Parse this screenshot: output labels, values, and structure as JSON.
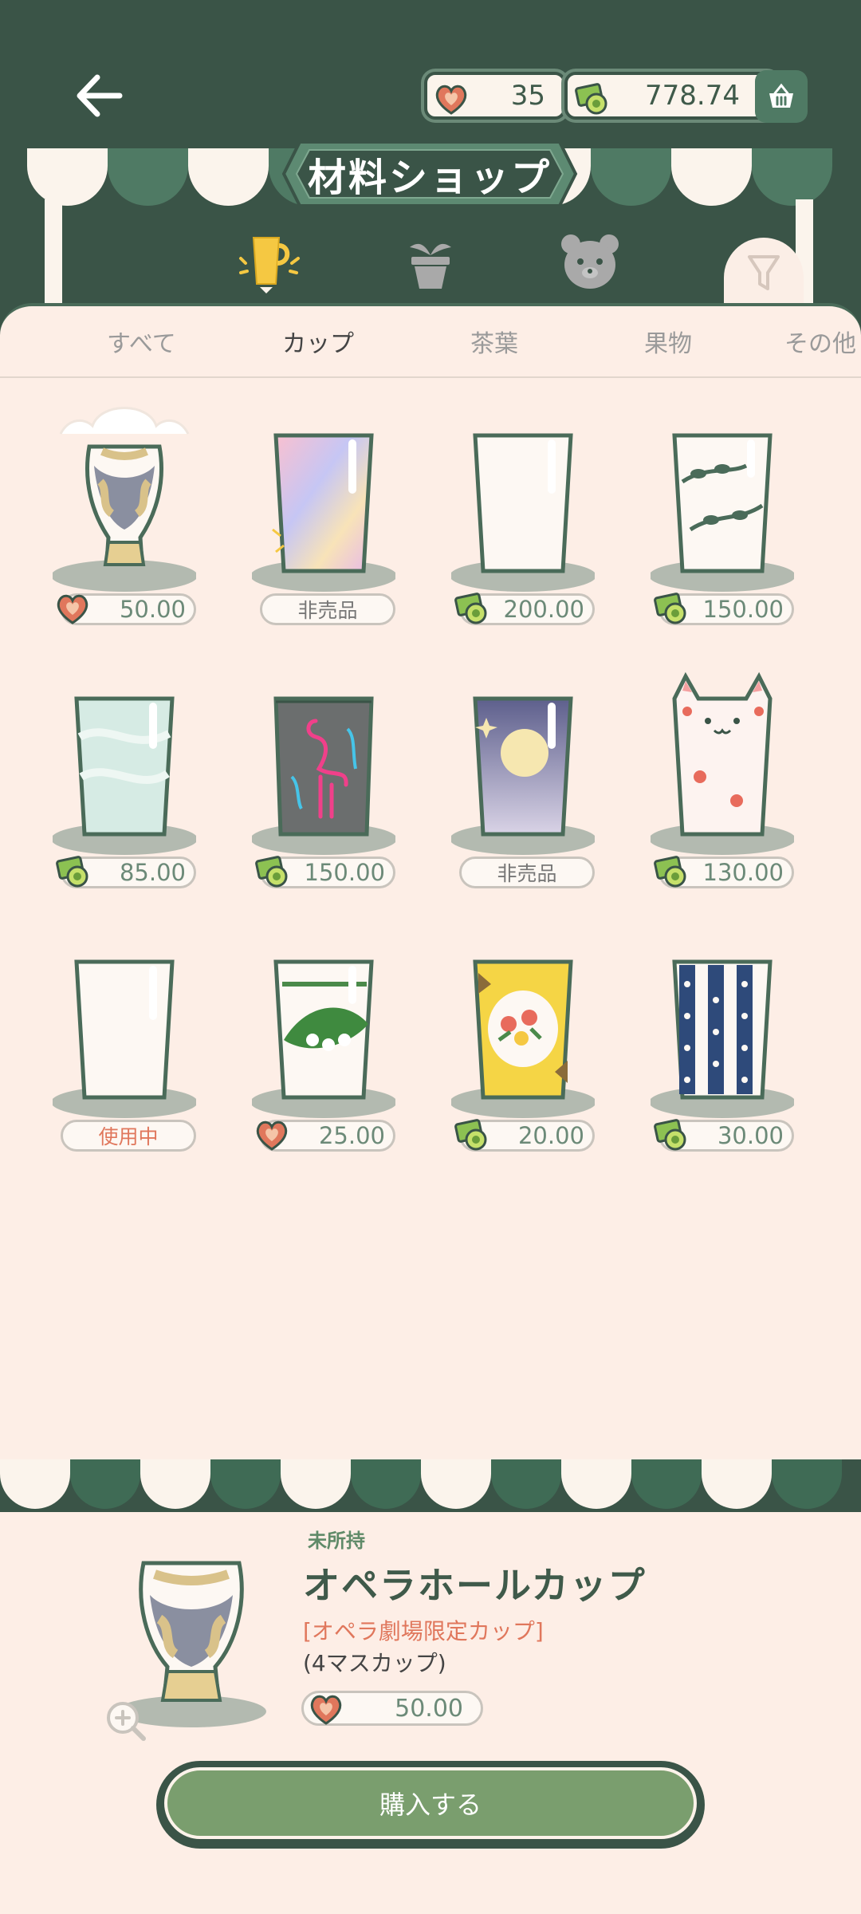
{
  "header": {
    "title": "材料ショップ",
    "hearts": "35",
    "money": "778.74"
  },
  "categories": [
    {
      "name": "cup-icon",
      "active": true
    },
    {
      "name": "plant-pot-icon",
      "active": false
    },
    {
      "name": "bear-icon",
      "active": false
    }
  ],
  "tabs": [
    {
      "label": "すべて"
    },
    {
      "label": "カップ"
    },
    {
      "label": "茶葉"
    },
    {
      "label": "果物"
    },
    {
      "label": "その他"
    }
  ],
  "items": [
    {
      "id": "opera",
      "currency": "heart",
      "price": "50.00"
    },
    {
      "id": "rainbow",
      "currency": "none",
      "price": "非売品"
    },
    {
      "id": "plain-glass",
      "currency": "money",
      "price": "200.00"
    },
    {
      "id": "vine",
      "currency": "money",
      "price": "150.00"
    },
    {
      "id": "marble",
      "currency": "money",
      "price": "85.00"
    },
    {
      "id": "flamingo",
      "currency": "money",
      "price": "150.00"
    },
    {
      "id": "moon",
      "currency": "none",
      "price": "非売品"
    },
    {
      "id": "cat",
      "currency": "money",
      "price": "130.00"
    },
    {
      "id": "basic",
      "currency": "none",
      "price": "使用中"
    },
    {
      "id": "lily",
      "currency": "heart",
      "price": "25.00"
    },
    {
      "id": "yellow-flower",
      "currency": "money",
      "price": "20.00"
    },
    {
      "id": "blue-dots",
      "currency": "money",
      "price": "30.00"
    }
  ],
  "detail": {
    "status": "未所持",
    "name": "オペラホールカップ",
    "subtitle": "[オペラ劇場限定カップ]",
    "size": "(4マスカップ)",
    "price": "50.00",
    "buy_label": "購入する"
  },
  "colors": {
    "dark_green": "#3a5447",
    "cream": "#fdeee6",
    "accent_green": "#7a9e6e",
    "accent_orange": "#e0775c",
    "cup_yellow": "#f5c842"
  }
}
